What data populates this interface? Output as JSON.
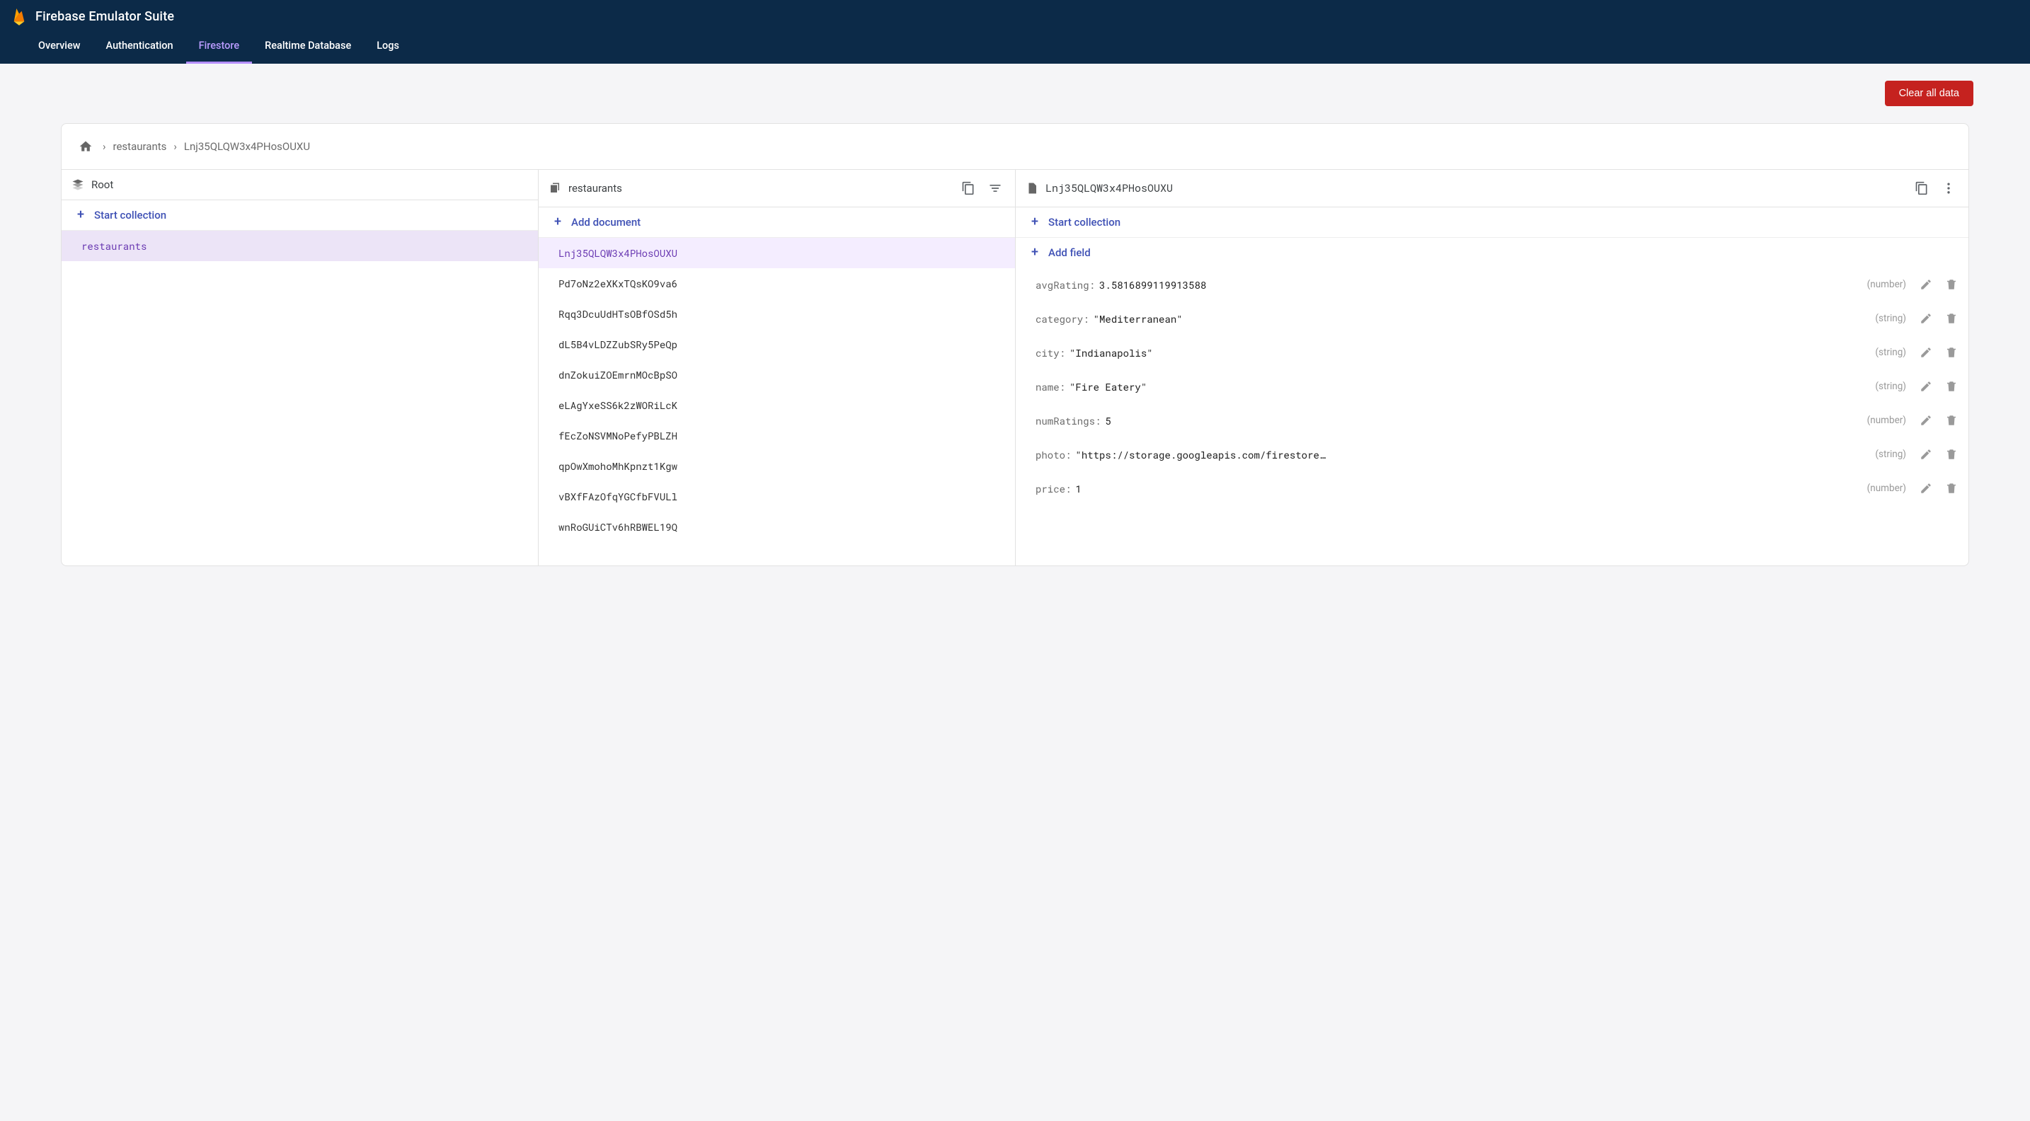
{
  "app_title": "Firebase Emulator Suite",
  "tabs": [
    "Overview",
    "Authentication",
    "Firestore",
    "Realtime Database",
    "Logs"
  ],
  "active_tab": 2,
  "clear_button": "Clear all data",
  "breadcrumb": [
    "restaurants",
    "Lnj35QLQW3x4PHosOUXU"
  ],
  "col_root": {
    "title": "Root",
    "add_label": "Start collection",
    "items": [
      "restaurants"
    ],
    "selected": 0
  },
  "col_docs": {
    "title": "restaurants",
    "add_label": "Add document",
    "items": [
      "Lnj35QLQW3x4PHosOUXU",
      "Pd7oNz2eXKxTQsKO9va6",
      "Rqq3DcuUdHTsOBfOSd5h",
      "dL5B4vLDZZubSRy5PeQp",
      "dnZokuiZOEmrnMOcBpSO",
      "eLAgYxeSS6k2zWORiLcK",
      "fEcZoNSVMNoPefyPBLZH",
      "qpOwXmohoMhKpnzt1Kgw",
      "vBXfFAzOfqYGCfbFVULl",
      "wnRoGUiCTv6hRBWEL19Q"
    ],
    "selected": 0
  },
  "col_fields": {
    "title": "Lnj35QLQW3x4PHosOUXU",
    "add_sub_label": "Start collection",
    "add_field_label": "Add field",
    "fields": [
      {
        "key": "avgRating",
        "value": "3.5816899119913588",
        "type": "number",
        "quoted": false
      },
      {
        "key": "category",
        "value": "Mediterranean",
        "type": "string",
        "quoted": true
      },
      {
        "key": "city",
        "value": "Indianapolis",
        "type": "string",
        "quoted": true
      },
      {
        "key": "name",
        "value": "Fire Eatery",
        "type": "string",
        "quoted": true
      },
      {
        "key": "numRatings",
        "value": "5",
        "type": "number",
        "quoted": false
      },
      {
        "key": "photo",
        "value": "https://storage.googleapis.com/firestorequickstarts.appspot.…",
        "type": "string",
        "quoted": true
      },
      {
        "key": "price",
        "value": "1",
        "type": "number",
        "quoted": false
      }
    ]
  }
}
